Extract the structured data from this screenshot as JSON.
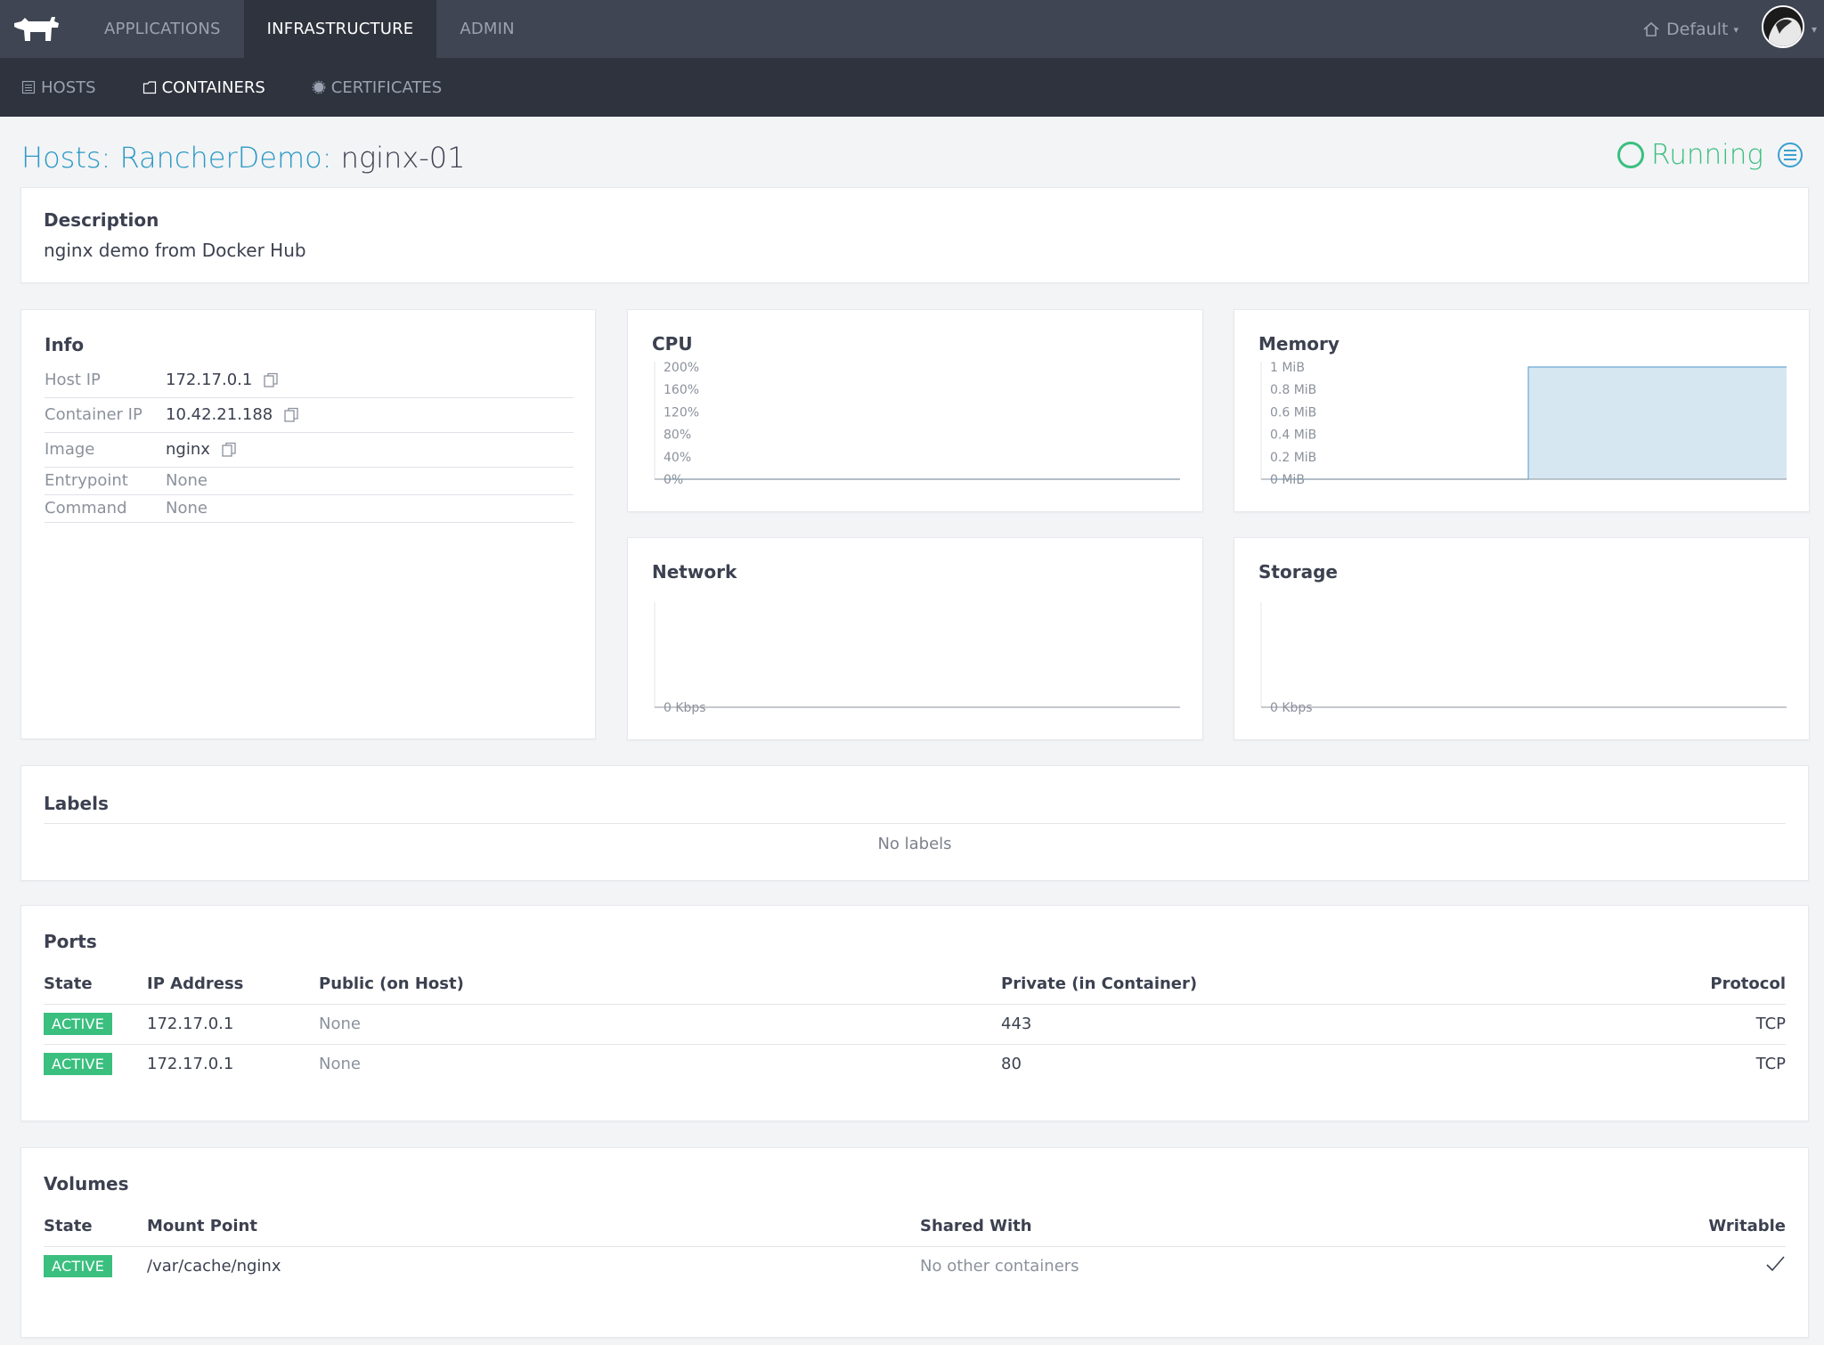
{
  "nav": {
    "tabs": [
      {
        "label": "APPLICATIONS"
      },
      {
        "label": "INFRASTRUCTURE",
        "active": true
      },
      {
        "label": "ADMIN"
      }
    ],
    "environment": "Default",
    "sub_tabs": [
      {
        "label": "HOSTS",
        "icon": "hosts-icon"
      },
      {
        "label": "CONTAINERS",
        "icon": "containers-icon",
        "active": true
      },
      {
        "label": "CERTIFICATES",
        "icon": "certificate-icon"
      }
    ]
  },
  "header": {
    "breadcrumb_prefix": "Hosts: RancherDemo:",
    "title": "nginx-01",
    "status": "Running"
  },
  "description": {
    "heading": "Description",
    "text": "nginx demo from Docker Hub"
  },
  "info": {
    "heading": "Info",
    "rows": [
      {
        "key": "Host IP",
        "value": "172.17.0.1"
      },
      {
        "key": "Container IP",
        "value": "10.42.21.188"
      },
      {
        "key": "Image",
        "value": "nginx"
      },
      {
        "key": "Entrypoint",
        "value": "None"
      },
      {
        "key": "Command",
        "value": "None"
      }
    ]
  },
  "charts": {
    "cpu": {
      "title": "CPU"
    },
    "memory": {
      "title": "Memory"
    },
    "network": {
      "title": "Network"
    },
    "storage": {
      "title": "Storage"
    }
  },
  "chart_data": [
    {
      "type": "area",
      "title": "CPU",
      "yticks": [
        "200%",
        "160%",
        "120%",
        "80%",
        "40%",
        "0%"
      ],
      "ylim": [
        0,
        200
      ],
      "x": [
        0,
        1
      ],
      "values": [
        0,
        0
      ],
      "grid": false
    },
    {
      "type": "area",
      "title": "Memory",
      "yticks": [
        "1 MiB",
        "0.8 MiB",
        "0.6 MiB",
        "0.4 MiB",
        "0.2 MiB",
        "0 MiB"
      ],
      "ylim": [
        0,
        1
      ],
      "x": [
        0,
        0.5,
        0.5,
        1
      ],
      "values": [
        0,
        0,
        1,
        1
      ],
      "grid": false
    },
    {
      "type": "line",
      "title": "Network",
      "yticks": [
        "0 Kbps"
      ],
      "values": [
        0,
        0
      ],
      "grid": false
    },
    {
      "type": "line",
      "title": "Storage",
      "yticks": [
        "0 Kbps"
      ],
      "values": [
        0,
        0
      ],
      "grid": false
    }
  ],
  "labels": {
    "heading": "Labels",
    "empty": "No labels"
  },
  "ports": {
    "heading": "Ports",
    "columns": [
      "State",
      "IP Address",
      "Public (on Host)",
      "Private (in Container)",
      "Protocol"
    ],
    "rows": [
      {
        "state": "ACTIVE",
        "ip": "172.17.0.1",
        "public": "None",
        "private": "443",
        "protocol": "TCP"
      },
      {
        "state": "ACTIVE",
        "ip": "172.17.0.1",
        "public": "None",
        "private": "80",
        "protocol": "TCP"
      }
    ]
  },
  "volumes": {
    "heading": "Volumes",
    "columns": [
      "State",
      "Mount Point",
      "Shared With",
      "Writable"
    ],
    "rows": [
      {
        "state": "ACTIVE",
        "mount": "/var/cache/nginx",
        "shared": "No other containers",
        "writable": true
      }
    ]
  },
  "colors": {
    "nav_bg": "#3f4552",
    "subnav_bg": "#2e333d",
    "accent": "#2b99c4",
    "success": "#3bbf7f",
    "memory_fill": "#cfe3f0"
  }
}
